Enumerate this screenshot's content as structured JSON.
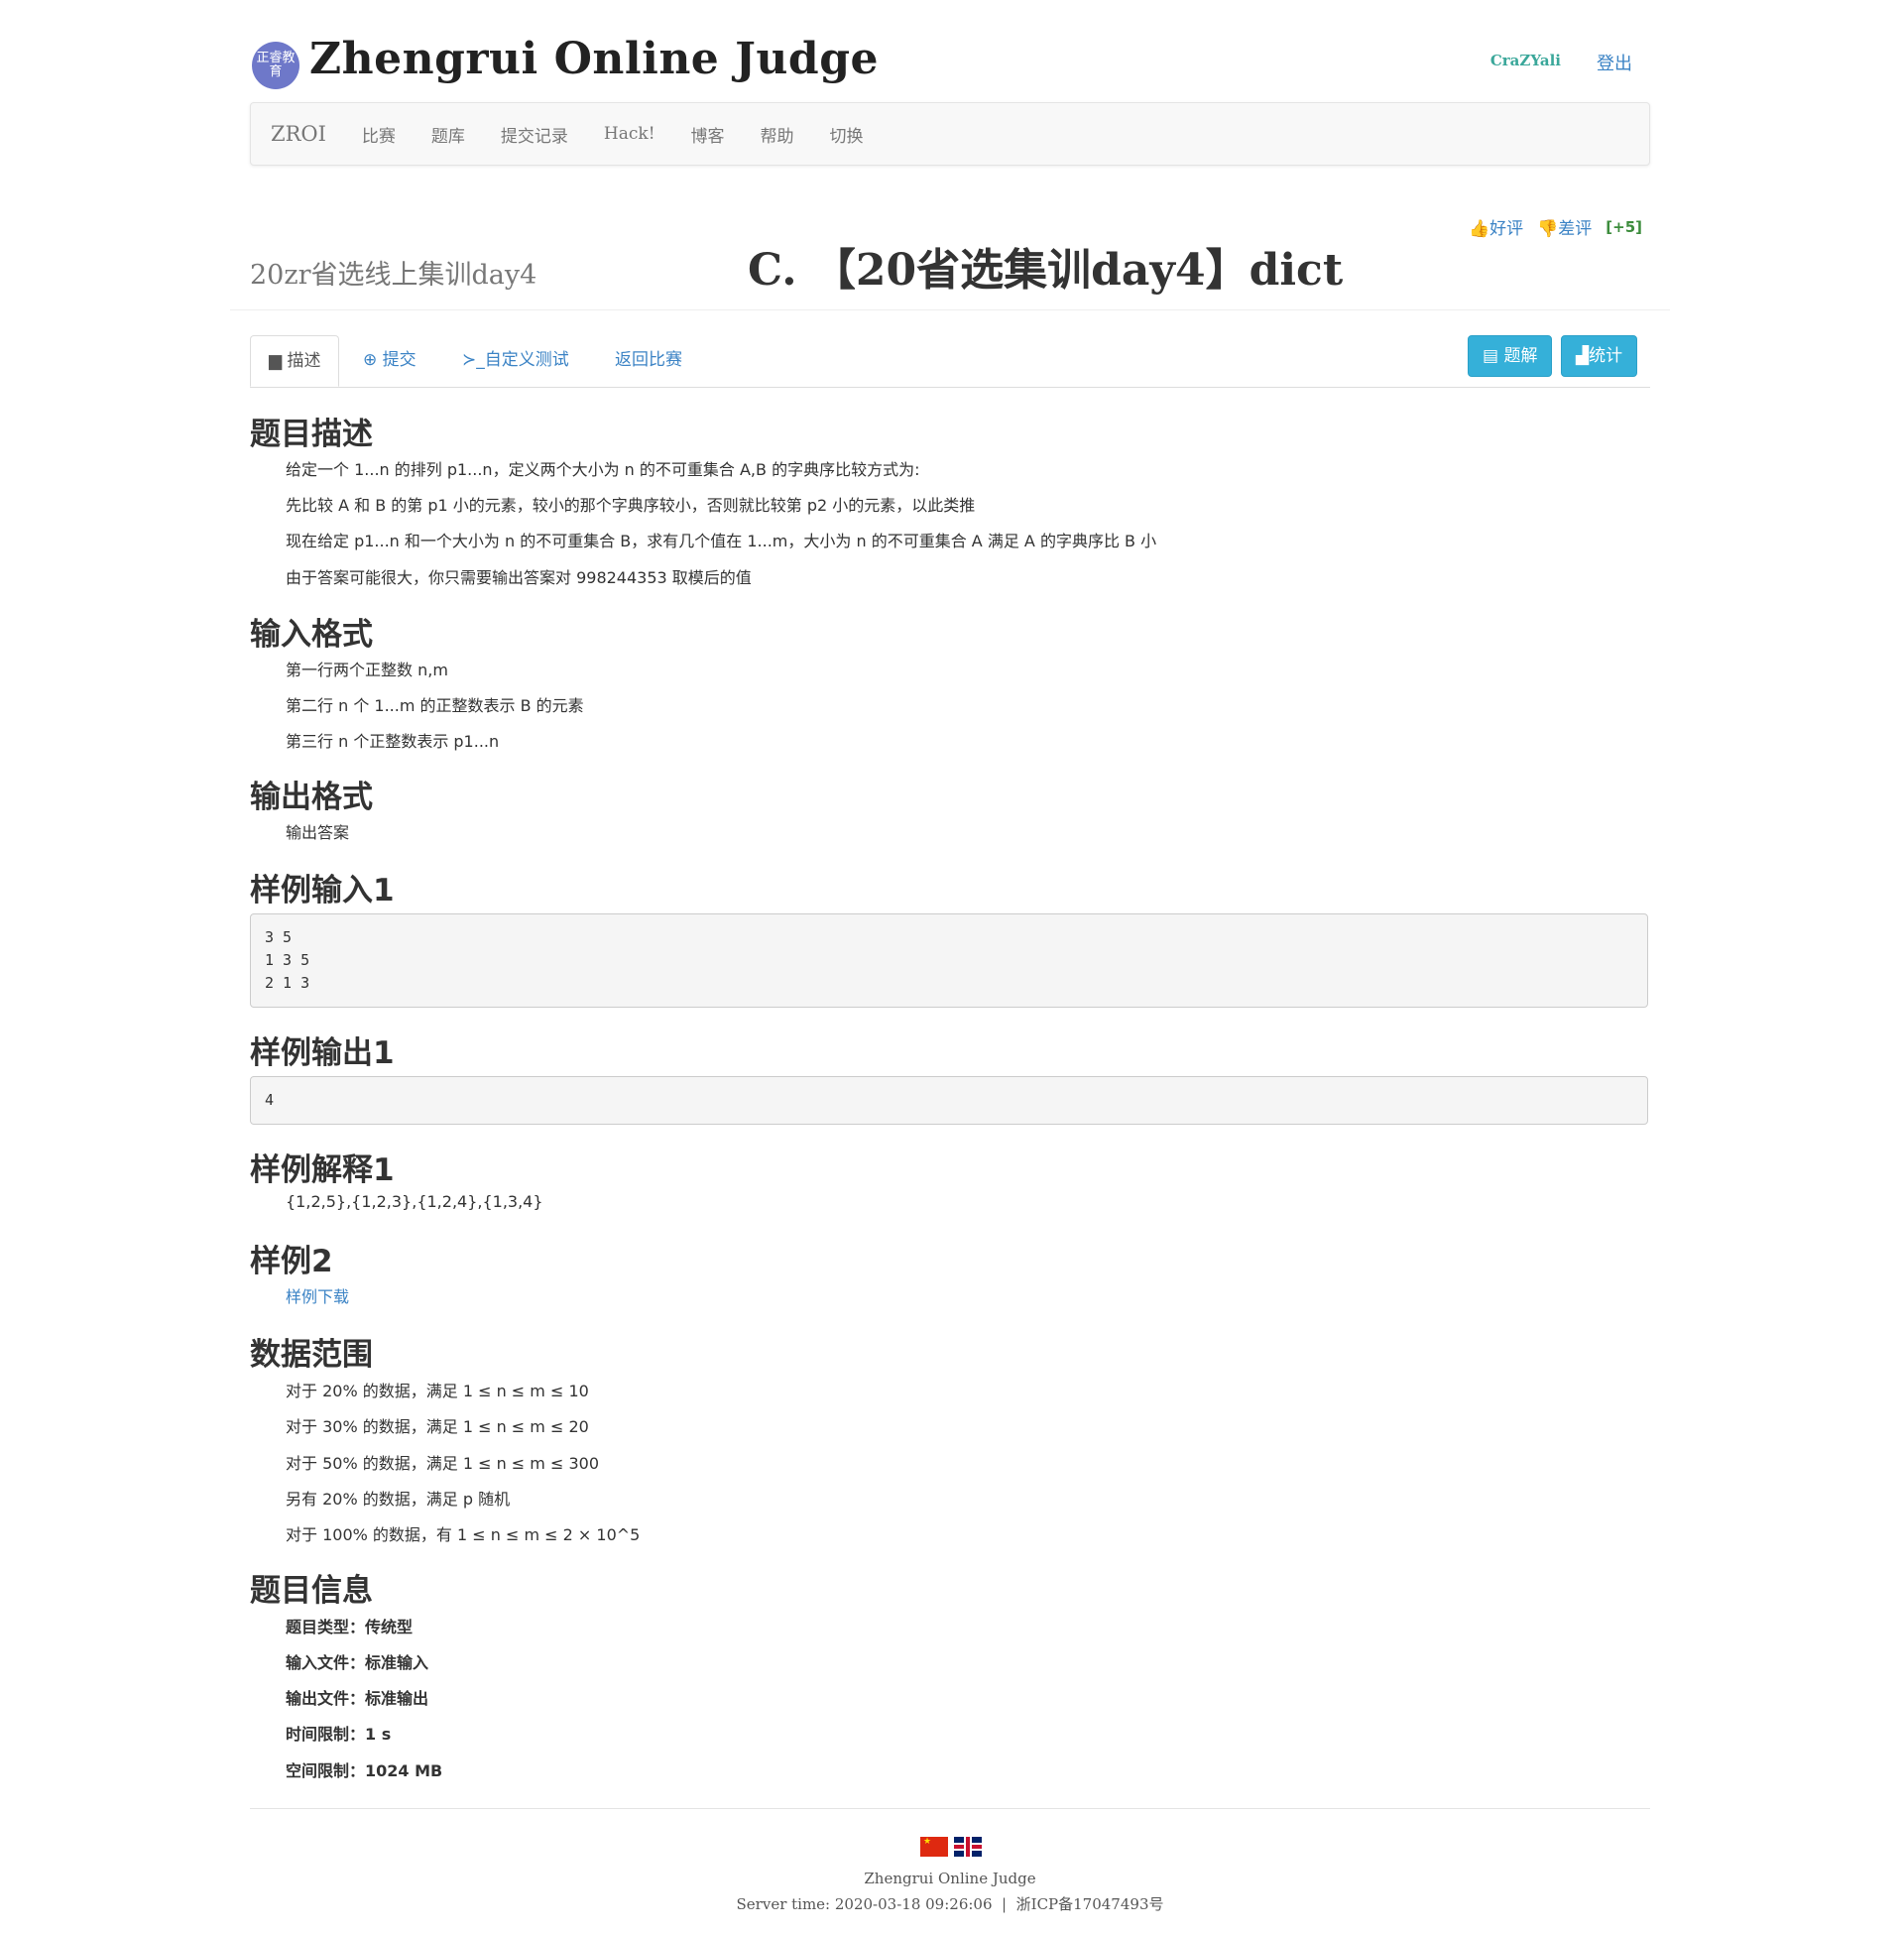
{
  "header": {
    "logo_text": "正睿教育",
    "site_title": "Zhengrui Online Judge",
    "username": "CraZYali",
    "logout": "登出"
  },
  "nav": {
    "brand": "ZROI",
    "items": [
      "比赛",
      "题库",
      "提交记录",
      "Hack!",
      "博客",
      "帮助",
      "切换"
    ]
  },
  "problem": {
    "contest_name": "20zr省选线上集训day4",
    "title": "C. 【20省选集训day4】dict",
    "upvote": "好评",
    "downvote": "差评",
    "score": "[+5]"
  },
  "tabs": {
    "describe": "描述",
    "submit": "提交",
    "custom_test": "自定义测试",
    "back": "返回比赛",
    "solution_btn": "题解",
    "stats_btn": "统计"
  },
  "sections": {
    "desc_title": "题目描述",
    "input_title": "输入格式",
    "output_title": "输出格式",
    "sample_in_title": "样例输入1",
    "sample_out_title": "样例输出1",
    "sample_explain_title": "样例解释1",
    "sample2_title": "样例2",
    "range_title": "数据范围",
    "info_title": "题目信息"
  },
  "description": [
    "给定一个 1...n 的排列 p1...n，定义两个大小为 n 的不可重集合 A,B 的字典序比较方式为:",
    "先比较 A 和 B 的第 p1 小的元素，较小的那个字典序较小，否则就比较第 p2 小的元素，以此类推",
    "现在给定 p1...n 和一个大小为 n 的不可重集合 B，求有几个值在 1...m，大小为 n 的不可重集合 A 满足 A 的字典序比 B 小",
    "由于答案可能很大，你只需要输出答案对 998244353 取模后的值"
  ],
  "input_format": [
    "第一行两个正整数 n,m",
    "第二行 n 个 1...m 的正整数表示 B 的元素",
    "第三行 n 个正整数表示 p1...n"
  ],
  "output_format": "输出答案",
  "sample_input": "3 5\n1 3 5\n2 1 3",
  "sample_output": "4",
  "sample_explain": "{1,2,5},{1,2,3},{1,2,4},{1,3,4}",
  "sample2_link": "样例下载",
  "data_range": [
    "对于 20% 的数据，满足 1 ≤ n ≤ m ≤ 10",
    "对于 30% 的数据，满足 1 ≤ n ≤ m ≤ 20",
    "对于 50% 的数据，满足 1 ≤ n ≤ m ≤ 300",
    "另有 20% 的数据，满足 p 随机",
    "对于 100% 的数据，有 1 ≤ n ≤ m ≤ 2 × 10^5"
  ],
  "info": {
    "type": "题目类型：传统型",
    "input_file": "输入文件：标准输入",
    "output_file": "输出文件：标准输出",
    "time_limit": "时间限制：1 s",
    "memory_limit": "空间限制：1024 MB"
  },
  "footer": {
    "site": "Zhengrui Online Judge",
    "server_time": "Server time: 2020-03-18 09:26:06",
    "icp": "浙ICP备17047493号"
  },
  "colors": {
    "link": "#3b83c5",
    "username": "#3aa79a",
    "button": "#35b0d9",
    "score": "#3c8c3c"
  }
}
